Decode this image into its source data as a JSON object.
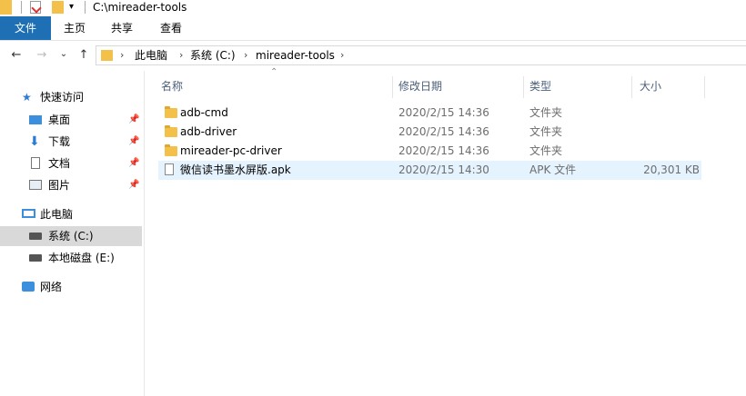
{
  "window": {
    "title": "C:\\mireader-tools"
  },
  "ribbon": {
    "tabs": [
      "文件",
      "主页",
      "共享",
      "查看"
    ]
  },
  "nav": {
    "back": "←",
    "forward": "→",
    "recent": "⌄",
    "up": "↑"
  },
  "breadcrumb": [
    "此电脑",
    "系统 (C:)",
    "mireader-tools"
  ],
  "sidebar": {
    "quick_access": "快速访问",
    "quick_items": [
      "桌面",
      "下载",
      "文档",
      "图片"
    ],
    "this_pc": "此电脑",
    "drives": [
      "系统 (C:)",
      "本地磁盘 (E:)"
    ],
    "network": "网络"
  },
  "columns": {
    "name": "名称",
    "date": "修改日期",
    "type": "类型",
    "size": "大小"
  },
  "files": [
    {
      "name": "adb-cmd",
      "date": "2020/2/15 14:36",
      "type": "文件夹",
      "size": "",
      "kind": "folder"
    },
    {
      "name": "adb-driver",
      "date": "2020/2/15 14:36",
      "type": "文件夹",
      "size": "",
      "kind": "folder"
    },
    {
      "name": "mireader-pc-driver",
      "date": "2020/2/15 14:36",
      "type": "文件夹",
      "size": "",
      "kind": "folder"
    },
    {
      "name": "微信读书墨水屏版.apk",
      "date": "2020/2/15 14:30",
      "type": "APK 文件",
      "size": "20,301 KB",
      "kind": "file"
    }
  ],
  "colors": {
    "file_tab": "#1f6fb5",
    "selected_row": "#e5f3ff",
    "folder": "#f3c14a"
  }
}
